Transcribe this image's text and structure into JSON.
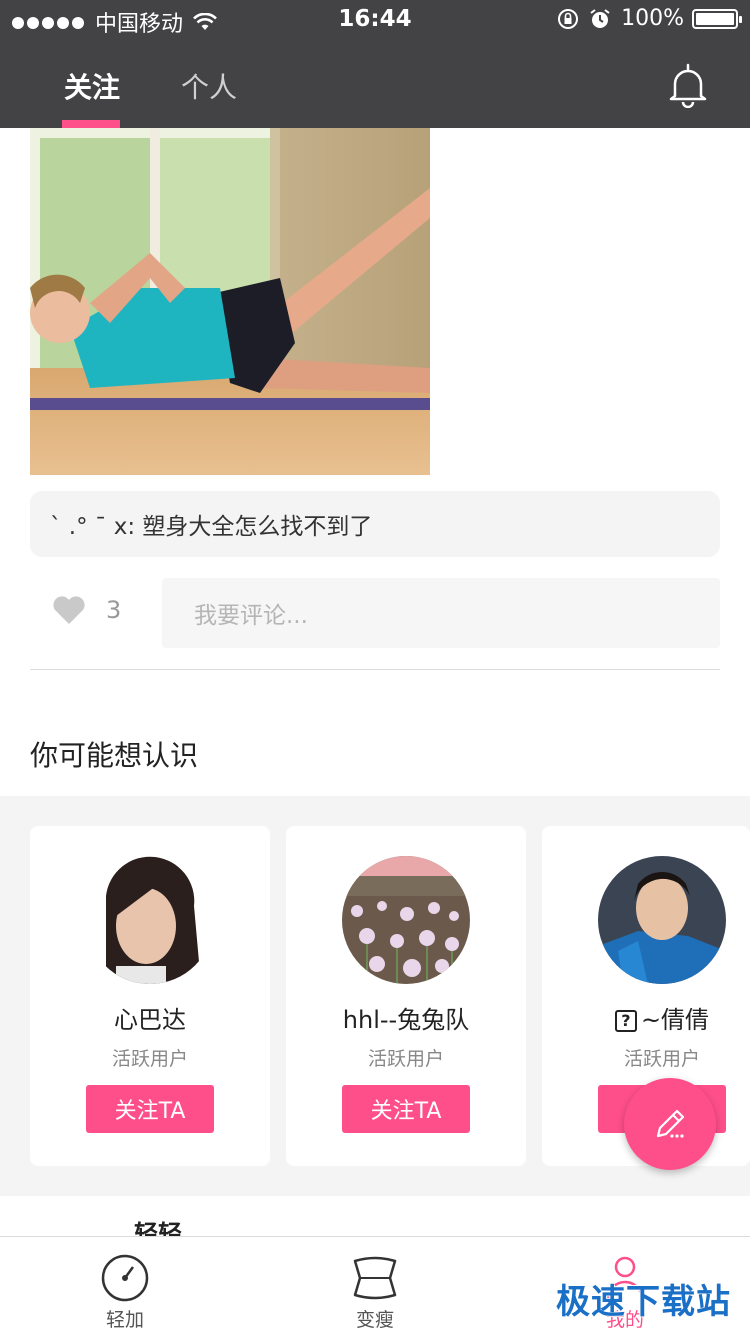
{
  "status_bar": {
    "carrier": "中国移动",
    "time": "16:44",
    "battery": "100%"
  },
  "nav": {
    "tabs": [
      {
        "label": "关注",
        "active": true
      },
      {
        "label": "个人",
        "active": false
      }
    ],
    "accent_color": "#ff4f8b",
    "background_color": "#434345"
  },
  "post": {
    "comment": "ˋ .° ˉ x: 塑身大全怎么找不到了",
    "likes": "3",
    "comment_placeholder": "我要评论..."
  },
  "suggestions": {
    "title": "你可能想认识",
    "users": [
      {
        "name": "心巴达",
        "subtitle": "活跃用户",
        "button": "关注TA"
      },
      {
        "name": "hhl--兔兔队",
        "subtitle": "活跃用户",
        "button": "关注TA"
      },
      {
        "name": "~倩倩",
        "prefix_glyph": "?",
        "subtitle": "活跃用户",
        "button": "关注TA"
      }
    ]
  },
  "next_post": {
    "author": "轻轻"
  },
  "tabbar": {
    "items": [
      {
        "label": "轻加",
        "icon": "gauge-icon"
      },
      {
        "label": "变瘦",
        "icon": "waist-icon"
      },
      {
        "label": "我的",
        "icon": "person-icon",
        "active": true
      }
    ]
  },
  "watermark": "极速下载站"
}
